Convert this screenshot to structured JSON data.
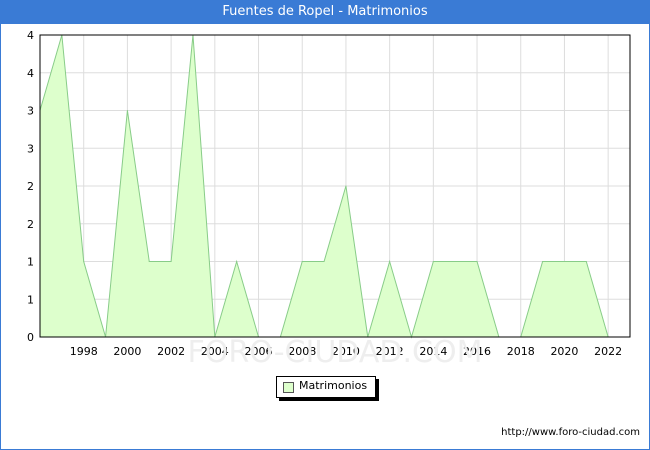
{
  "title": "Fuentes de Ropel - Matrimonios",
  "footer_url": "http://www.foro-ciudad.com",
  "watermark": "FORO-CIUDAD.COM",
  "colors": {
    "header": "#3a7bd5",
    "fill": "#ddffcc",
    "line": "#88cc88",
    "grid": "#dddddd"
  },
  "chart_data": {
    "type": "area",
    "x": [
      1996,
      1997,
      1998,
      1999,
      2000,
      2001,
      2002,
      2003,
      2004,
      2005,
      2006,
      2007,
      2008,
      2009,
      2010,
      2011,
      2012,
      2013,
      2014,
      2015,
      2016,
      2017,
      2018,
      2019,
      2020,
      2021,
      2022
    ],
    "series": [
      {
        "name": "Matrimonios",
        "values": [
          3,
          4,
          1,
          0,
          3,
          1,
          1,
          4,
          0,
          1,
          0,
          0,
          1,
          1,
          2,
          0,
          1,
          0,
          1,
          1,
          1,
          0,
          0,
          1,
          1,
          1,
          0
        ]
      }
    ],
    "xticks": [
      1998,
      2000,
      2002,
      2004,
      2006,
      2008,
      2010,
      2012,
      2014,
      2016,
      2018,
      2020,
      2022
    ],
    "yticks": [
      "0",
      "1",
      "1",
      "2",
      "2",
      "3",
      "3",
      "4",
      "4"
    ],
    "ylim": [
      0,
      4
    ],
    "xlim": [
      1996,
      2023
    ],
    "grid": true,
    "legend": "bottom-center"
  }
}
